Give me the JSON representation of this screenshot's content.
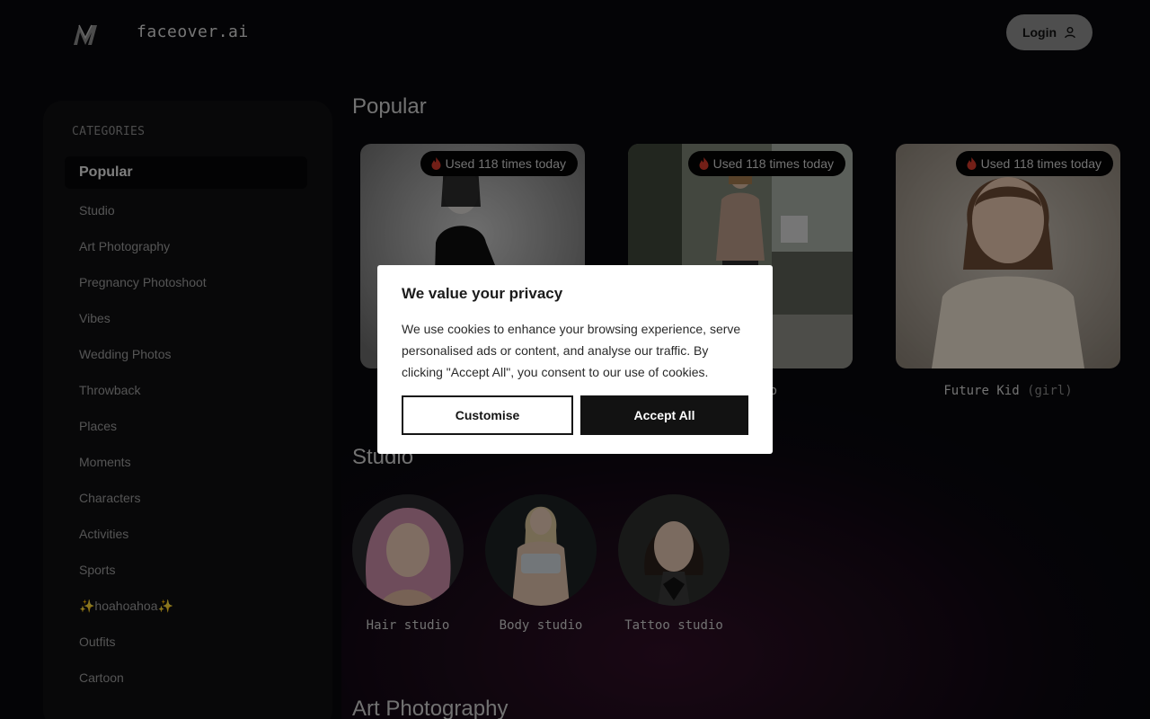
{
  "header": {
    "brand": "faceover.ai",
    "login_label": "Login"
  },
  "sidebar": {
    "title": "CATEGORIES",
    "items": [
      {
        "label": "Popular",
        "active": true
      },
      {
        "label": "Studio"
      },
      {
        "label": "Art Photography"
      },
      {
        "label": "Pregnancy Photoshoot"
      },
      {
        "label": "Vibes"
      },
      {
        "label": "Wedding Photos"
      },
      {
        "label": "Throwback"
      },
      {
        "label": "Places"
      },
      {
        "label": "Moments"
      },
      {
        "label": "Characters"
      },
      {
        "label": "Activities"
      },
      {
        "label": "Sports"
      },
      {
        "label": "✨hoahoahoa✨"
      },
      {
        "label": "Outfits"
      },
      {
        "label": "Cartoon"
      }
    ]
  },
  "popular": {
    "title": "Popular",
    "cards": [
      {
        "badge": "Used 118 times today",
        "caption": "",
        "caption_sub": ""
      },
      {
        "badge": "Used 118 times today",
        "caption": "o",
        "caption_sub": ""
      },
      {
        "badge": "Used 118 times today",
        "caption": "Future Kid",
        "caption_sub": "(girl)"
      }
    ]
  },
  "studio": {
    "title": "Studio",
    "items": [
      {
        "label": "Hair studio"
      },
      {
        "label": "Body studio"
      },
      {
        "label": "Tattoo studio"
      }
    ]
  },
  "art": {
    "title": "Art Photography"
  },
  "cookie": {
    "title": "We value your privacy",
    "text": "We use cookies to enhance your browsing experience, serve personalised ads or content, and analyse our traffic. By clicking \"Accept All\", you consent to our use of cookies.",
    "customise_label": "Customise",
    "accept_label": "Accept All"
  },
  "colors": {
    "background": "#08080b",
    "sidebar": "#0f0f12",
    "login_button": "#8e8e8e",
    "badge_fire": "#d23a2a"
  },
  "icons": [
    "logo-icon",
    "user-icon",
    "fire-icon"
  ]
}
